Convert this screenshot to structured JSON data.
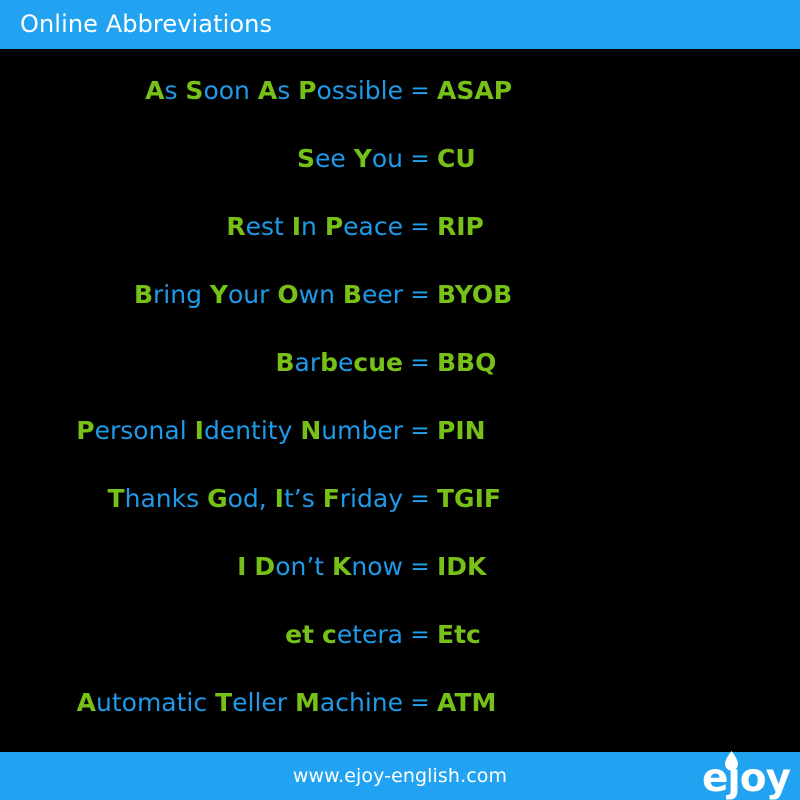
{
  "header": {
    "title": "Online Abbreviations",
    "background_color": "#22A3F1",
    "text_color": "#FFFFFF"
  },
  "theme": {
    "background_color": "#000000",
    "accent_blue": "#22A3F1",
    "phrase_initial_color": "#76C017",
    "phrase_body_color": "#1E9AE8",
    "abbreviation_color": "#76C017",
    "equals_color": "#22A3F1"
  },
  "main": {
    "equals_sign": "=",
    "rows": [
      {
        "phrase": "As Soon As Possible",
        "abbreviation": "ASAP",
        "segments": [
          {
            "text": "A",
            "style": "cap"
          },
          {
            "text": "s ",
            "style": "low"
          },
          {
            "text": "S",
            "style": "cap"
          },
          {
            "text": "oon ",
            "style": "low"
          },
          {
            "text": "A",
            "style": "cap"
          },
          {
            "text": "s ",
            "style": "low"
          },
          {
            "text": "P",
            "style": "cap"
          },
          {
            "text": "ossible",
            "style": "low"
          }
        ]
      },
      {
        "phrase": "See You",
        "abbreviation": "CU",
        "segments": [
          {
            "text": "S",
            "style": "cap"
          },
          {
            "text": "ee ",
            "style": "low"
          },
          {
            "text": "Y",
            "style": "cap"
          },
          {
            "text": "ou",
            "style": "low"
          }
        ]
      },
      {
        "phrase": "Rest In Peace",
        "abbreviation": "RIP",
        "segments": [
          {
            "text": "R",
            "style": "cap"
          },
          {
            "text": "est ",
            "style": "low"
          },
          {
            "text": "I",
            "style": "cap"
          },
          {
            "text": "n ",
            "style": "low"
          },
          {
            "text": "P",
            "style": "cap"
          },
          {
            "text": "eace",
            "style": "low"
          }
        ]
      },
      {
        "phrase": "Bring Your Own Beer",
        "abbreviation": "BYOB",
        "segments": [
          {
            "text": "B",
            "style": "cap"
          },
          {
            "text": "ring ",
            "style": "low"
          },
          {
            "text": "Y",
            "style": "cap"
          },
          {
            "text": "our ",
            "style": "low"
          },
          {
            "text": "O",
            "style": "cap"
          },
          {
            "text": "wn ",
            "style": "low"
          },
          {
            "text": "B",
            "style": "cap"
          },
          {
            "text": "eer",
            "style": "low"
          }
        ]
      },
      {
        "phrase": "Barbecue",
        "abbreviation": "BBQ",
        "segments": [
          {
            "text": "B",
            "style": "cap"
          },
          {
            "text": "ar",
            "style": "low"
          },
          {
            "text": "b",
            "style": "cap"
          },
          {
            "text": "e",
            "style": "low"
          },
          {
            "text": "cue",
            "style": "cap"
          }
        ]
      },
      {
        "phrase": "Personal Identity Number",
        "abbreviation": "PIN",
        "segments": [
          {
            "text": "P",
            "style": "cap"
          },
          {
            "text": "ersonal ",
            "style": "low"
          },
          {
            "text": "I",
            "style": "cap"
          },
          {
            "text": "dentity ",
            "style": "low"
          },
          {
            "text": "N",
            "style": "cap"
          },
          {
            "text": "umber",
            "style": "low"
          }
        ]
      },
      {
        "phrase": "Thanks God, It’s Friday",
        "abbreviation": "TGIF",
        "segments": [
          {
            "text": "T",
            "style": "cap"
          },
          {
            "text": "hanks ",
            "style": "low"
          },
          {
            "text": "G",
            "style": "cap"
          },
          {
            "text": "od, ",
            "style": "low"
          },
          {
            "text": "I",
            "style": "cap"
          },
          {
            "text": "t’s ",
            "style": "low"
          },
          {
            "text": "F",
            "style": "cap"
          },
          {
            "text": "riday",
            "style": "low"
          }
        ]
      },
      {
        "phrase": "I Don’t Know",
        "abbreviation": "IDK",
        "segments": [
          {
            "text": "I",
            "style": "cap"
          },
          {
            "text": " ",
            "style": "low"
          },
          {
            "text": "D",
            "style": "cap"
          },
          {
            "text": "on’t ",
            "style": "low"
          },
          {
            "text": "K",
            "style": "cap"
          },
          {
            "text": "now",
            "style": "low"
          }
        ]
      },
      {
        "phrase": "et cetera",
        "abbreviation": "Etc",
        "segments": [
          {
            "text": "et",
            "style": "cap"
          },
          {
            "text": " ",
            "style": "low"
          },
          {
            "text": "c",
            "style": "cap"
          },
          {
            "text": "etera",
            "style": "low"
          }
        ]
      },
      {
        "phrase": "Automatic Teller Machine",
        "abbreviation": "ATM",
        "segments": [
          {
            "text": "A",
            "style": "cap"
          },
          {
            "text": "utomatic ",
            "style": "low"
          },
          {
            "text": "T",
            "style": "cap"
          },
          {
            "text": "eller ",
            "style": "low"
          },
          {
            "text": "M",
            "style": "cap"
          },
          {
            "text": "achine",
            "style": "low"
          }
        ]
      }
    ]
  },
  "footer": {
    "url": "www.ejoy-english.com",
    "logo_text": "ejoy",
    "logo_icon": "flame-drop-icon",
    "background_color": "#22A3F1",
    "text_color": "#FFFFFF"
  }
}
